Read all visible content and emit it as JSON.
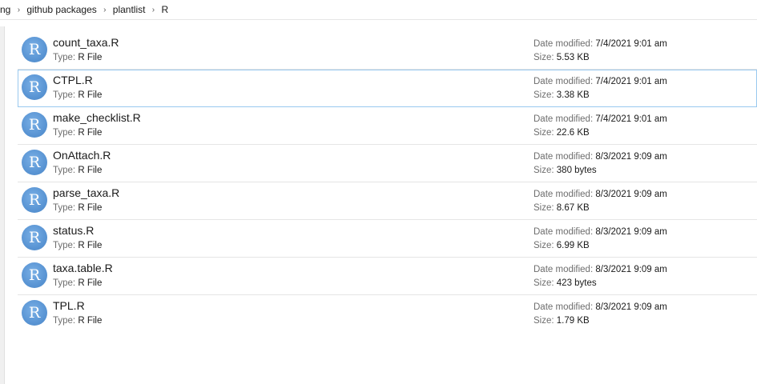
{
  "breadcrumb": {
    "items": [
      "ng",
      "github packages",
      "plantlist",
      "R"
    ]
  },
  "labels": {
    "type": "Type:",
    "date_modified": "Date modified:",
    "size": "Size:"
  },
  "icon": {
    "name": "r-file-icon",
    "letter": "R",
    "color": "#5a95d4"
  },
  "files": [
    {
      "name": "count_taxa.R",
      "type": "R File",
      "date": "7/4/2021 9:01 am",
      "size": "5.53 KB"
    },
    {
      "name": "CTPL.R",
      "type": "R File",
      "date": "7/4/2021 9:01 am",
      "size": "3.38 KB"
    },
    {
      "name": "make_checklist.R",
      "type": "R File",
      "date": "7/4/2021 9:01 am",
      "size": "22.6 KB"
    },
    {
      "name": "OnAttach.R",
      "type": "R File",
      "date": "8/3/2021 9:09 am",
      "size": "380 bytes"
    },
    {
      "name": "parse_taxa.R",
      "type": "R File",
      "date": "8/3/2021 9:09 am",
      "size": "8.67 KB"
    },
    {
      "name": "status.R",
      "type": "R File",
      "date": "8/3/2021 9:09 am",
      "size": "6.99 KB"
    },
    {
      "name": "taxa.table.R",
      "type": "R File",
      "date": "8/3/2021 9:09 am",
      "size": "423 bytes"
    },
    {
      "name": "TPL.R",
      "type": "R File",
      "date": "8/3/2021 9:09 am",
      "size": "1.79 KB"
    }
  ],
  "colors": {
    "selection_border": "#99c9ef",
    "label_gray": "#6d6d6d"
  }
}
